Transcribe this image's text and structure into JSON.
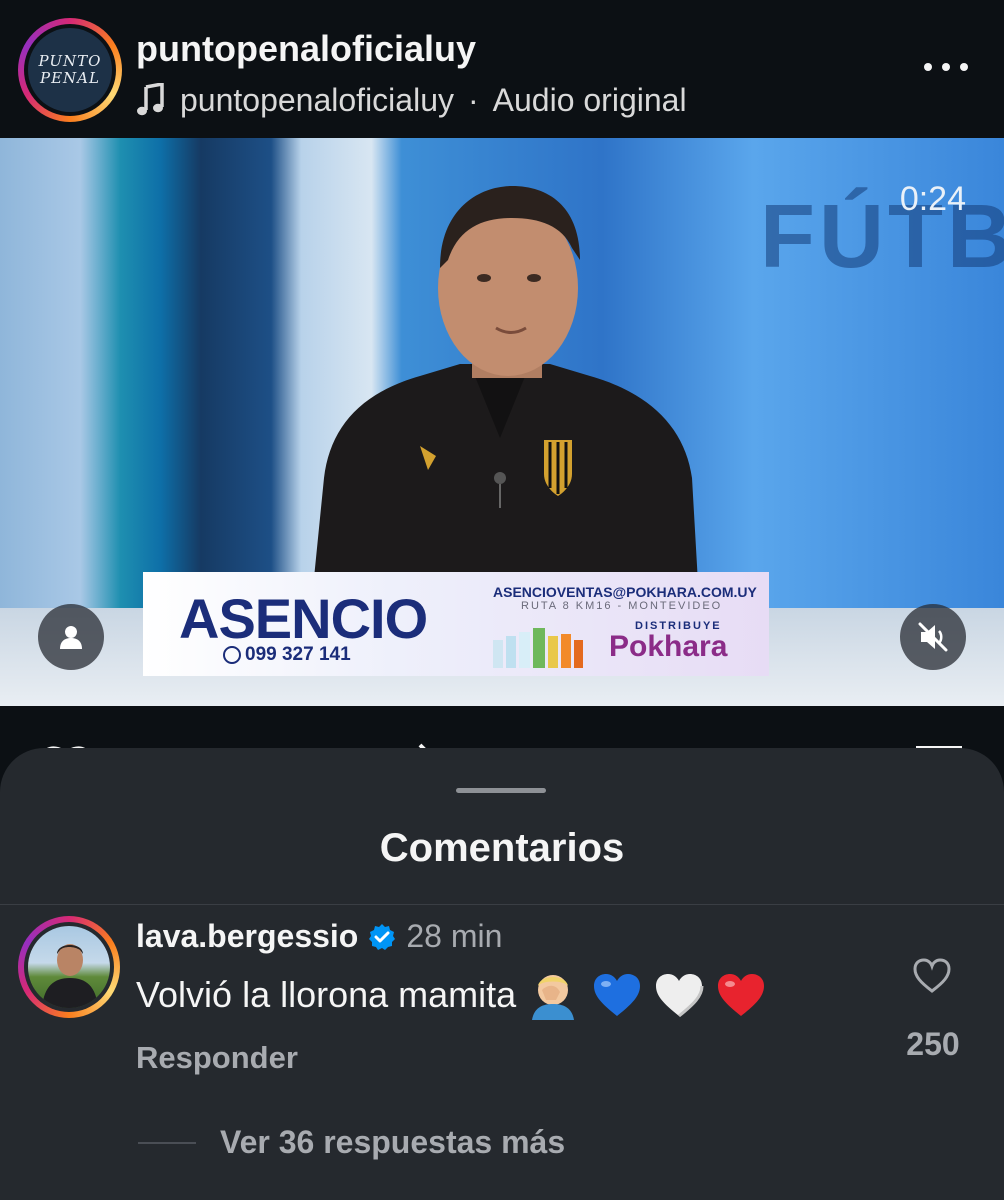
{
  "post": {
    "username": "puntopenaloficialuy",
    "audio_owner": "puntopenaloficialuy",
    "audio_separator": "·",
    "audio_label": "Audio original",
    "avatar_line1": "PUNTO",
    "avatar_line2": "PENAL"
  },
  "video": {
    "timestamp": "0:24",
    "background_word": "FÚTBOL",
    "banner": {
      "brand": "ASENCIO",
      "phone": "099 327 141",
      "email": "ASENCIOVENTAS@POKHARA.COM.UY",
      "route": "RUTA 8 KM16 - MONTEVIDEO",
      "distribuye": "DISTRIBUYE",
      "distributor": "Pokhara"
    },
    "muted": true
  },
  "comments_sheet": {
    "title": "Comentarios",
    "comment": {
      "username": "lava.bergessio",
      "verified": true,
      "time": "28 min",
      "text": "Volvió la llorona mamita",
      "emojis": [
        "facepalm",
        "blue-heart",
        "white-heart",
        "red-heart"
      ],
      "reply_label": "Responder",
      "like_count": "250",
      "view_replies": "Ver 36 respuestas más"
    }
  },
  "colors": {
    "background": "#0c1014",
    "sheet": "#25292e",
    "secondary_text": "#a8abb0",
    "verified_blue": "#0095f6"
  }
}
